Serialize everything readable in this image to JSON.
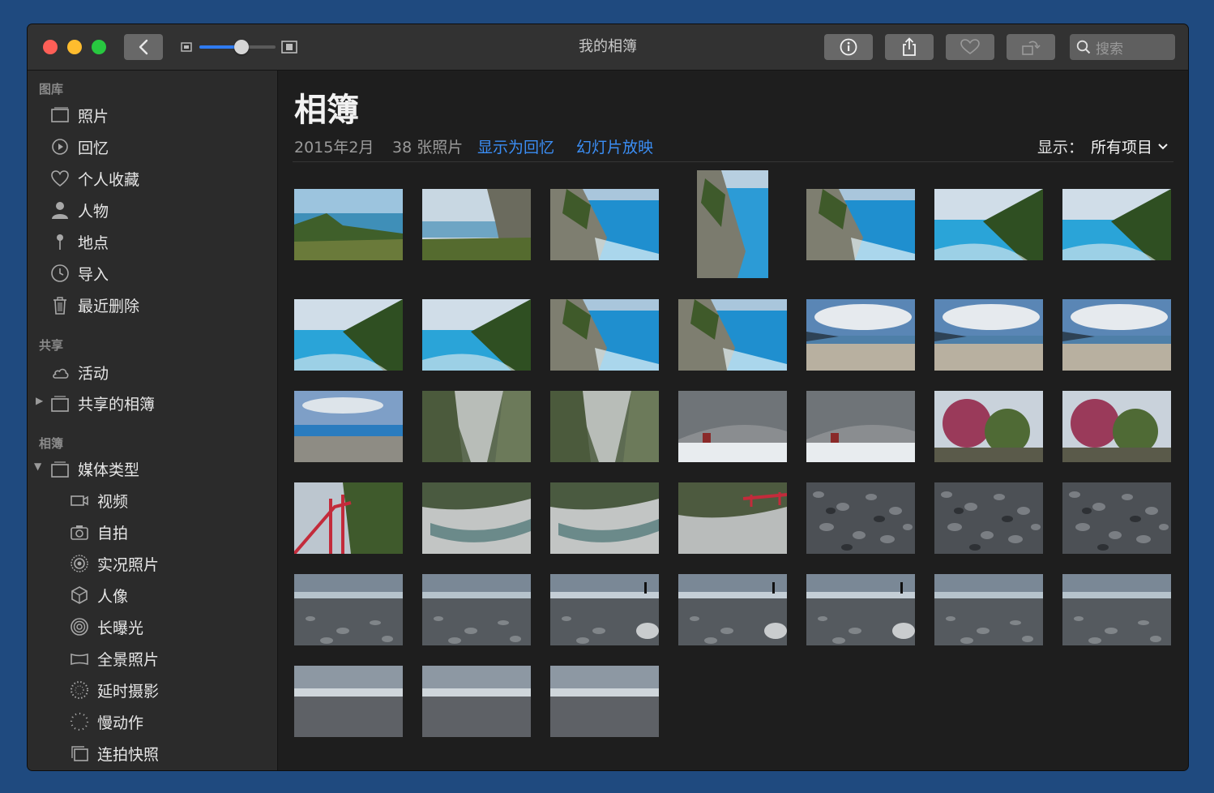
{
  "window": {
    "title": "我的相簿"
  },
  "toolbar": {
    "search_placeholder": "搜索"
  },
  "sidebar": {
    "sections": {
      "library": "图库",
      "shared": "共享",
      "albums": "相簿"
    },
    "library_items": [
      {
        "label": "照片",
        "icon": "photos-icon"
      },
      {
        "label": "回忆",
        "icon": "memories-icon"
      },
      {
        "label": "个人收藏",
        "icon": "heart-icon"
      },
      {
        "label": "人物",
        "icon": "person-icon"
      },
      {
        "label": "地点",
        "icon": "pin-icon"
      },
      {
        "label": "导入",
        "icon": "clock-icon"
      },
      {
        "label": "最近删除",
        "icon": "trash-icon"
      }
    ],
    "shared_items": [
      {
        "label": "活动",
        "icon": "cloud-icon"
      },
      {
        "label": "共享的相簿",
        "icon": "shared-album-icon"
      }
    ],
    "album_items": [
      {
        "label": "媒体类型",
        "icon": "album-icon"
      },
      {
        "label": "视频",
        "icon": "video-icon"
      },
      {
        "label": "自拍",
        "icon": "selfie-camera-icon"
      },
      {
        "label": "实况照片",
        "icon": "live-photo-icon"
      },
      {
        "label": "人像",
        "icon": "cube-icon"
      },
      {
        "label": "长曝光",
        "icon": "long-exposure-icon"
      },
      {
        "label": "全景照片",
        "icon": "panorama-icon"
      },
      {
        "label": "延时摄影",
        "icon": "timelapse-icon"
      },
      {
        "label": "慢动作",
        "icon": "slowmo-icon"
      },
      {
        "label": "连拍快照",
        "icon": "burst-icon"
      }
    ]
  },
  "main": {
    "heading": "相簿",
    "date": "2015年2月",
    "count": "38 张照片",
    "show_as_memory": "显示为回忆",
    "slideshow": "幻灯片放映",
    "show_label": "显示：",
    "show_value": "所有项目"
  },
  "colors": {
    "accent": "#3b8ef5",
    "window_bg": "#1e1e1e",
    "sidebar_bg": "#2b2b2b",
    "desktop": "#1f4a7f"
  },
  "photos": [
    {
      "scene": "coast-cliff-grass"
    },
    {
      "scene": "cliff-grass"
    },
    {
      "scene": "cliff-sea"
    },
    {
      "scene": "cliff-sea-portrait"
    },
    {
      "scene": "cliff-sea"
    },
    {
      "scene": "bay-mountain"
    },
    {
      "scene": "bay-mountain"
    },
    {
      "scene": "bay-mountain"
    },
    {
      "scene": "bay-mountain"
    },
    {
      "scene": "cliff-sea"
    },
    {
      "scene": "cliff-sea"
    },
    {
      "scene": "beach-clouds"
    },
    {
      "scene": "beach-clouds"
    },
    {
      "scene": "beach-clouds"
    },
    {
      "scene": "beach-horizon"
    },
    {
      "scene": "gorge"
    },
    {
      "scene": "gorge"
    },
    {
      "scene": "rock-cave"
    },
    {
      "scene": "rock-cave"
    },
    {
      "scene": "blossom-tree"
    },
    {
      "scene": "blossom-tree"
    },
    {
      "scene": "red-bridge"
    },
    {
      "scene": "gorge-river"
    },
    {
      "scene": "gorge-river"
    },
    {
      "scene": "gorge-bridge"
    },
    {
      "scene": "pebbles"
    },
    {
      "scene": "pebbles"
    },
    {
      "scene": "pebbles"
    },
    {
      "scene": "pebble-beach"
    },
    {
      "scene": "pebble-beach"
    },
    {
      "scene": "pebble-beach-person"
    },
    {
      "scene": "pebble-beach-person"
    },
    {
      "scene": "pebble-beach-person"
    },
    {
      "scene": "pebble-beach"
    },
    {
      "scene": "pebble-beach"
    },
    {
      "scene": "grey-beach"
    },
    {
      "scene": "grey-beach"
    },
    {
      "scene": "grey-beach"
    }
  ]
}
